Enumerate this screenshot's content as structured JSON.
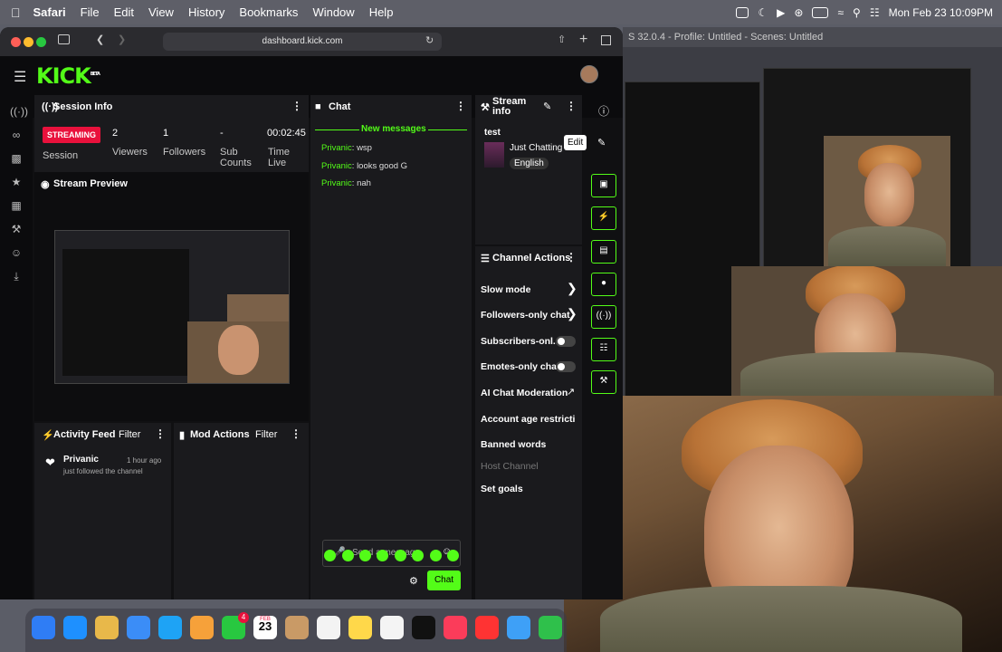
{
  "menubar": {
    "app": "Safari",
    "items": [
      "File",
      "Edit",
      "View",
      "History",
      "Bookmarks",
      "Window",
      "Help"
    ],
    "datetime": "Mon Feb 23  10:09PM"
  },
  "browser": {
    "url": "dashboard.kick.com"
  },
  "kick": {
    "logo": "KICK",
    "beta": "BETA"
  },
  "session": {
    "title": "Session Info",
    "status": "STREAMING",
    "status_label": "Session",
    "viewers_value": "2",
    "viewers_label": "Viewers",
    "followers_value": "1",
    "followers_label": "Followers",
    "subs_value": "-",
    "subs_label": "Sub Counts",
    "time_value": "00:02:45",
    "time_label": "Time Live"
  },
  "preview": {
    "title": "Stream Preview"
  },
  "activity": {
    "title": "Activity Feed",
    "filter": "Filter",
    "user": "Privanic",
    "time": "1 hour ago",
    "desc": "just followed the channel"
  },
  "mod": {
    "title": "Mod Actions",
    "filter": "Filter"
  },
  "chat": {
    "title": "Chat",
    "new_messages": "New messages",
    "messages": [
      {
        "user": "Privanic",
        "text": ": wsp"
      },
      {
        "user": "Privanic",
        "text": ": looks good G"
      },
      {
        "user": "Privanic",
        "text": ": nah"
      }
    ],
    "placeholder": "Send a message",
    "send": "Chat"
  },
  "stream_info": {
    "title": "Stream info",
    "stream_title": "test",
    "category": "Just Chatting",
    "language": "English",
    "edit_tooltip": "Edit"
  },
  "channel_actions": {
    "title": "Channel Actions",
    "items": [
      "Slow mode",
      "Followers-only chat",
      "Subscribers-onl...",
      "Emotes-only chat",
      "AI Chat Moderation",
      "Account age restricti",
      "Banned words",
      "Host Channel",
      "Set goals"
    ]
  },
  "obs": {
    "title": "S 32.0.4 - Profile: Untitled - Scenes: Untitled"
  },
  "dock": {
    "calendar_month": "FEB",
    "calendar_day": "23",
    "badge": "4"
  },
  "colors": {
    "accent": "#53fc18",
    "streaming": "#e9113c",
    "panel": "#1a1a1d"
  }
}
